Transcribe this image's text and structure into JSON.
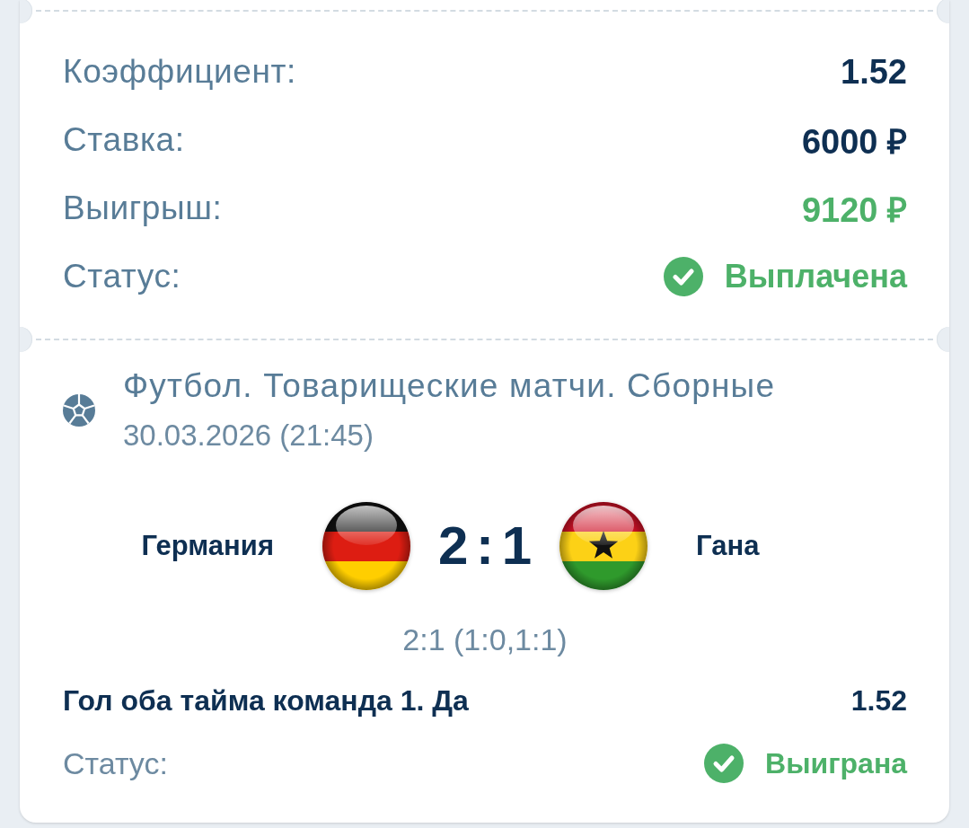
{
  "summary": [
    {
      "label": "Коэффициент:",
      "value": "1.52",
      "kind": "plain"
    },
    {
      "label": "Ставка:",
      "value": "6000 ₽",
      "kind": "plain"
    },
    {
      "label": "Выигрыш:",
      "value": "9120 ₽",
      "kind": "win"
    },
    {
      "label": "Статус:",
      "value": "Выплачена",
      "kind": "status"
    }
  ],
  "event": {
    "title": "Футбол. Товарищеские матчи. Сборные",
    "date": "30.03.2026 (21:45)",
    "teams": [
      {
        "name": "Германия",
        "kind": "germany"
      },
      {
        "name": "Гана",
        "kind": "ghana"
      }
    ],
    "score": "2 : 1",
    "periods": "2:1 (1:0,1:1)"
  },
  "bet": {
    "market": "Гол оба тайма команда 1. Да",
    "odds": "1.52",
    "status_label": "Статус:",
    "status": "Выиграна"
  }
}
